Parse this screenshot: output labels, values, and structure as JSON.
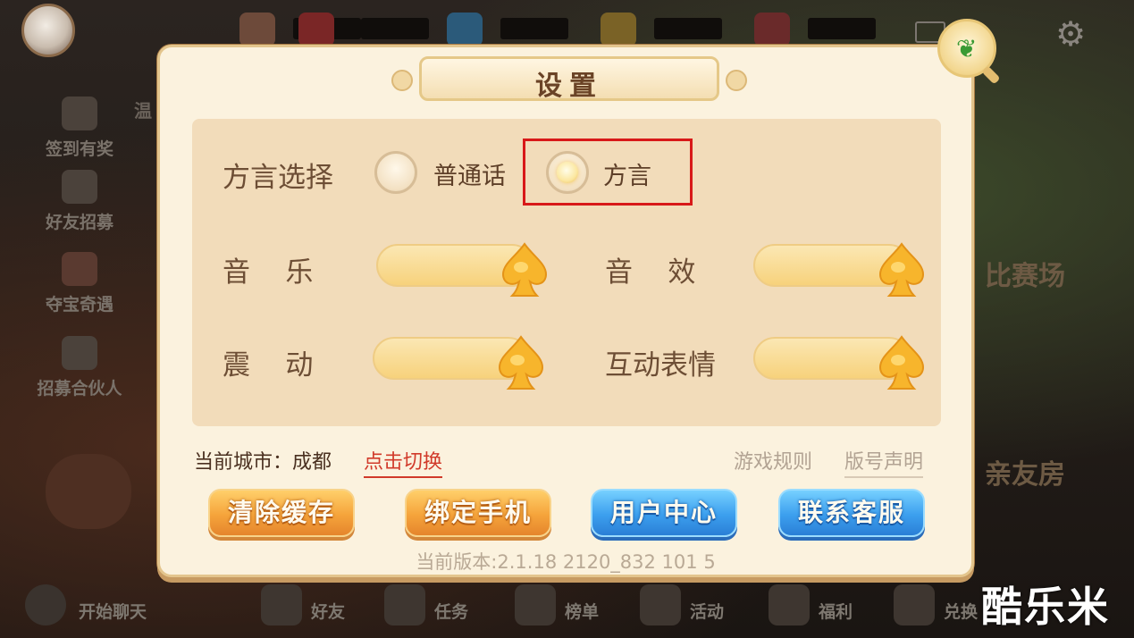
{
  "background": {
    "side_items": [
      "签到有奖",
      "好友招募",
      "夺宝奇遇",
      "招募合伙人"
    ],
    "right_labels": [
      "比赛场",
      "亲友房"
    ],
    "partial_tag": "温",
    "bottom_nav": [
      "开始聊天",
      "好友",
      "任务",
      "榜单",
      "活动",
      "福利",
      "兑换"
    ],
    "watermark": "酷乐米"
  },
  "dialog": {
    "title": "设置",
    "dialect": {
      "label": "方言选择",
      "options": [
        "普通话",
        "方言"
      ],
      "selected": "方言"
    },
    "sliders": [
      {
        "label": "音    乐",
        "level": 1.0
      },
      {
        "label": "音    效",
        "level": 1.0
      },
      {
        "label": "震    动",
        "level": 1.0
      },
      {
        "label": "互动表情",
        "level": 1.0
      }
    ],
    "city_label": "当前城市：成都",
    "switch_link": "点击切换",
    "rules_link": "游戏规则",
    "version_link": "版号声明",
    "buttons": [
      "清除缓存",
      "绑定手机",
      "用户中心",
      "联系客服"
    ],
    "version_text": "当前版本:2.1.18 2120_832 101 5"
  },
  "colors": {
    "highlight_box": "#d81919",
    "orange_button": "#f5a43b",
    "blue_button": "#3c9fee",
    "link_red": "#d13a2a"
  }
}
